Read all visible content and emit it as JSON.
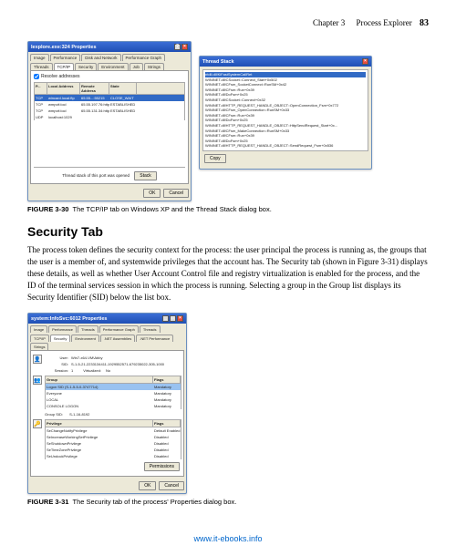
{
  "header": {
    "chapter": "Chapter 3",
    "title": "Process Explorer",
    "page": "83"
  },
  "fig30": {
    "win1": {
      "title": "Iexplore.exe:324 Properties",
      "tabs_row1": [
        "Image",
        "Performance",
        "Disk and Network",
        "Performance Graph"
      ],
      "tabs_row2": [
        "Threads",
        "TCP/IP",
        "Security",
        "Environment",
        "Job",
        "Strings"
      ],
      "checkbox": "Resolve addresses",
      "columns": [
        "P...",
        "Local Address",
        "Remote Address",
        "State"
      ],
      "rows": [
        {
          "p": "TCP",
          "la": "wincard.local:ftp",
          "ra": "65.55...:55215",
          "st": "CLOSE_WAIT"
        },
        {
          "p": "TCP",
          "la": "wmpvti:locl",
          "ra": "65.55.197.76:http",
          "st": "ESTABLISHED"
        },
        {
          "p": "TCP",
          "la": "wmpvti:locl",
          "ra": "65.55.131.34:http",
          "st": "ESTABLISHED"
        },
        {
          "p": "UDP",
          "la": "localhost:1029",
          "ra": "",
          "st": ""
        }
      ],
      "status": "Thread stack of this port was opened",
      "stack_btn": "Stack",
      "ok": "OK",
      "cancel": "Cancel"
    },
    "win2": {
      "title": "Thread Stack",
      "items": [
        "ntdll.dll!KiFastSystemCallRet",
        "WININET.dll!CSocket::Connect_Start+0x502",
        "WININET.dll!CFsm_SocketConnect::RunSM+0x42",
        "WININET.dll!CFsm::Run+0x39",
        "WININET.dll!DoFsm+0x25",
        "WININET.dll!CSocket::Connect+0x32",
        "WININET.dll!HTTP_REQUEST_HANDLE_OBJECT::OpenConnection_Fsm+0x772",
        "WININET.dll!CFsm_OpenConnection::RunSM+0x33",
        "WININET.dll!CFsm::Run+0x39",
        "WININET.dll!DoFsm+0x25",
        "WININET.dll!HTTP_REQUEST_HANDLE_OBJECT::HttpSendRequest_Start+0x...",
        "WININET.dll!CFsm_MakeConnection::RunSM+0x33",
        "WININET.dll!CFsm::Run+0x39",
        "WININET.dll!DoFsm+0x25",
        "WININET.dll!HTTP_REQUEST_HANDLE_OBJECT::SendRequest_Fsm+0x536"
      ],
      "copy": "Copy"
    },
    "caption_label": "FIGURE 3-30",
    "caption_text": "The TCP/IP tab on Windows XP and the Thread Stack dialog box."
  },
  "security_section": {
    "heading": "Security Tab",
    "body": "The process token defines the security context for the process: the user principal the process is running as, the groups that the user is a member of, and systemwide privileges that the account has. The Security tab (shown in Figure 3-31) displays these details, as well as whether User Account Control file and registry virtualization is enabled for the process, and the ID of the terminal services session in which the process is running. Selecting a group in the Group list displays its Security Identifier (SID) below the list box."
  },
  "fig31": {
    "title": "system:InfoSvc:6012 Properties",
    "tabs_row1": [
      "Image",
      "Performance",
      "Threads",
      "Performance Graph",
      "Threads"
    ],
    "tabs_row2": [
      "TCP/IP",
      "Security",
      "Environment",
      ".NET Assemblies",
      ".NET Performance",
      "Strings"
    ],
    "user_label": "User:",
    "user_value": "Win7-x64-VM\\Abby",
    "sid_label": "SID:",
    "sid_value": "S-1-5-21-2233134411-1929552571-679235022-305-1000",
    "session_label": "Session:",
    "session_value": "1",
    "virt_label": "Virtualized:",
    "virt_value": "No",
    "group_col": "Group",
    "flags_col": "Flags",
    "groups": [
      {
        "g": "Logon SID (S-1-5-5-0-3747714)",
        "f": "Mandatory"
      },
      {
        "g": "Everyone",
        "f": "Mandatory"
      },
      {
        "g": "LOCAL",
        "f": "Mandatory"
      },
      {
        "g": "CONSOLE LOGON",
        "f": "Mandatory"
      }
    ],
    "group_sid_label": "Group SID:",
    "group_sid_value": "S-1-16-8192",
    "priv_col": "Privilege",
    "privflags_col": "Flags",
    "privileges": [
      {
        "p": "SeChangeNotifyPrivilege",
        "f": "Default Enabled"
      },
      {
        "p": "SeIncreaseWorkingSetPrivilege",
        "f": "Disabled"
      },
      {
        "p": "SeShutdownPrivilege",
        "f": "Disabled"
      },
      {
        "p": "SeTimeZonePrivilege",
        "f": "Disabled"
      },
      {
        "p": "SeUndockPrivilege",
        "f": "Disabled"
      }
    ],
    "permissions_btn": "Permissions",
    "ok": "OK",
    "cancel": "Cancel",
    "caption_label": "FIGURE 3-31",
    "caption_text": "The Security tab of the process' Properties dialog box."
  },
  "footer": {
    "link": "www.it-ebooks.info"
  }
}
